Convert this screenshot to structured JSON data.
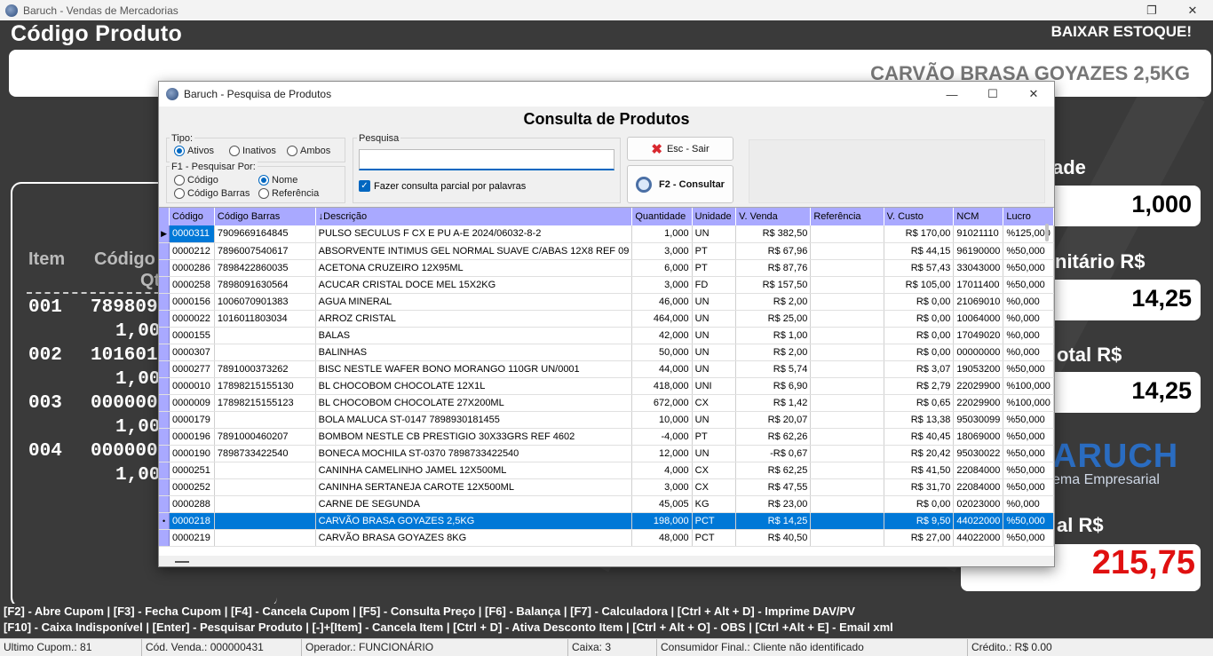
{
  "window": {
    "title": "Baruch - Vendas de Mercadorias"
  },
  "main": {
    "codigo_title": "Código Produto",
    "baixar_estoque": "BAIXAR ESTOQUE!",
    "product_name": "CARVÃO BRASA GOYAZES 2,5KG",
    "items_header": {
      "item": "Item",
      "codigo": "Código",
      "qt": "Qt"
    },
    "items": [
      {
        "num": "001",
        "code": "789809",
        "qty": "1,00"
      },
      {
        "num": "002",
        "code": "101601",
        "qty": "1,00"
      },
      {
        "num": "003",
        "code": "000000",
        "qty": "1,00"
      },
      {
        "num": "004",
        "code": "000000",
        "qty": "1,00"
      }
    ],
    "right": {
      "qty_label": "ade",
      "qty_value": "1,000",
      "unit_label": "nitário R$",
      "unit_value": "14,25",
      "total_item_label": "otal R$",
      "total_item_value": "14,25",
      "total_label": "al R$",
      "total_value": "215,75"
    },
    "brand": {
      "name": "ARUCH",
      "sub": "ema Empresarial"
    }
  },
  "shortcuts": {
    "line1": "[F2] - Abre Cupom  | [F3] - Fecha Cupom  | [F4] - Cancela Cupom  | [F5] - Consulta Preço  | [F6] - Balança  | [F7] - Calculadora  | [Ctrl + Alt + D] - Imprime DAV/PV",
    "line2": "[F10] - Caixa Indisponível  | [Enter] - Pesquisar Produto  | [-]+[Item] - Cancela Item  | [Ctrl + D] - Ativa Desconto Item  | [Ctrl + Alt + O] - OBS  | [Ctrl +Alt + E] - Email xml"
  },
  "statusbar": {
    "ultimo_cupom": "Ultimo Cupom.: 81",
    "cod_venda": "Cód. Venda.: 000000431",
    "operador": "Operador.: FUNCIONÁRIO",
    "caixa": "Caixa: 3",
    "consumidor": "Consumidor Final.: Cliente não identificado",
    "credito": "Crédito.: R$ 0.00"
  },
  "dialog": {
    "title": "Baruch - Pesquisa de Produtos",
    "heading": "Consulta de Produtos",
    "tipo": {
      "caption": "Tipo:",
      "options": [
        "Ativos",
        "Inativos",
        "Ambos"
      ],
      "selected": "Ativos"
    },
    "pesquisar_por": {
      "caption": "F1 - Pesquisar Por:",
      "options": [
        "Código",
        "Nome",
        "Código Barras",
        "Referência"
      ],
      "selected": "Nome"
    },
    "pesquisa": {
      "caption": "Pesquisa",
      "value": ""
    },
    "partial_label": "Fazer consulta parcial por palavras",
    "btn_sair": "Esc - Sair",
    "btn_consultar": "F2 - Consultar",
    "columns": [
      "Código",
      "Código Barras",
      "Descrição",
      "Quantidade",
      "Unidade",
      "V. Venda",
      "Referência",
      "V. Custo",
      "NCM",
      "Lucro"
    ],
    "rows": [
      [
        "0000311",
        "7909669164845",
        " PULSO SECULUS F CX E PU A-E 2024/06032-8-2",
        "1,000",
        "UN",
        "R$ 382,50",
        "",
        "R$ 170,00",
        "91021110",
        "%125,000"
      ],
      [
        "0000212",
        "7896007540617",
        "ABSORVENTE INTIMUS GEL NORMAL SUAVE C/ABAS 12X8 REF 09",
        "3,000",
        "PT",
        "R$ 67,96",
        "",
        "R$ 44,15",
        "96190000",
        "%50,000"
      ],
      [
        "0000286",
        "7898422860035",
        "ACETONA CRUZEIRO 12X95ML",
        "6,000",
        "PT",
        "R$ 87,76",
        "",
        "R$ 57,43",
        "33043000",
        "%50,000"
      ],
      [
        "0000258",
        "7898091630564",
        "ACUCAR CRISTAL DOCE MEL 15X2KG",
        "3,000",
        "FD",
        "R$ 157,50",
        "",
        "R$ 105,00",
        "17011400",
        "%50,000"
      ],
      [
        "0000156",
        "1006070901383",
        "AGUA MINERAL",
        "46,000",
        "UN",
        "R$ 2,00",
        "",
        "R$ 0,00",
        "21069010",
        "%0,000"
      ],
      [
        "0000022",
        "1016011803034",
        "ARROZ CRISTAL",
        "464,000",
        "UN",
        "R$ 25,00",
        "",
        "R$ 0,00",
        "10064000",
        "%0,000"
      ],
      [
        "0000155",
        "",
        "BALAS",
        "42,000",
        "UN",
        "R$ 1,00",
        "",
        "R$ 0,00",
        "17049020",
        "%0,000"
      ],
      [
        "0000307",
        "",
        "BALINHAS",
        "50,000",
        "UN",
        "R$ 2,00",
        "",
        "R$ 0,00",
        "00000000",
        "%0,000"
      ],
      [
        "0000277",
        "7891000373262",
        "BISC NESTLE WAFER BONO MORANGO 110GR UN/0001",
        "44,000",
        "UN",
        "R$ 5,74",
        "",
        "R$ 3,07",
        "19053200",
        "%50,000"
      ],
      [
        "0000010",
        "17898215155130",
        "BL CHOCOBOM CHOCOLATE 12X1L",
        "418,000",
        "UNI",
        "R$ 6,90",
        "",
        "R$ 2,79",
        "22029900",
        "%100,000"
      ],
      [
        "0000009",
        "17898215155123",
        "BL CHOCOBOM CHOCOLATE 27X200ML",
        "672,000",
        "CX",
        "R$ 1,42",
        "",
        "R$ 0,65",
        "22029900",
        "%100,000"
      ],
      [
        "0000179",
        "",
        "BOLA MALUCA ST-0147 7898930181455",
        "10,000",
        "UN",
        "R$ 20,07",
        "",
        "R$ 13,38",
        "95030099",
        "%50,000"
      ],
      [
        "0000196",
        "7891000460207",
        "BOMBOM NESTLE CB PRESTIGIO 30X33GRS REF 4602",
        "-4,000",
        "PT",
        "R$ 62,26",
        "",
        "R$ 40,45",
        "18069000",
        "%50,000"
      ],
      [
        "0000190",
        "7898733422540",
        "BONECA MOCHILA ST-0370 7898733422540",
        "12,000",
        "UN",
        "-R$ 0,67",
        "",
        "R$ 20,42",
        "95030022",
        "%50,000"
      ],
      [
        "0000251",
        "",
        "CANINHA CAMELINHO JAMEL 12X500ML",
        "4,000",
        "CX",
        "R$ 62,25",
        "",
        "R$ 41,50",
        "22084000",
        "%50,000"
      ],
      [
        "0000252",
        "",
        "CANINHA SERTANEJA CAROTE 12X500ML",
        "3,000",
        "CX",
        "R$ 47,55",
        "",
        "R$ 31,70",
        "22084000",
        "%50,000"
      ],
      [
        "0000288",
        "",
        "CARNE DE SEGUNDA",
        "45,005",
        "KG",
        "R$ 23,00",
        "",
        "R$ 0,00",
        "02023000",
        "%0,000"
      ],
      [
        "0000218",
        "",
        "CARVÃO BRASA GOYAZES 2,5KG",
        "198,000",
        "PCT",
        "R$ 14,25",
        "",
        "R$ 9,50",
        "44022000",
        "%50,000"
      ],
      [
        "0000219",
        "",
        "CARVÃO BRASA GOYAZES 8KG",
        "48,000",
        "PCT",
        "R$ 40,50",
        "",
        "R$ 27,00",
        "44022000",
        "%50,000"
      ]
    ],
    "current_row_index": 0,
    "selected_row_index": 17
  }
}
